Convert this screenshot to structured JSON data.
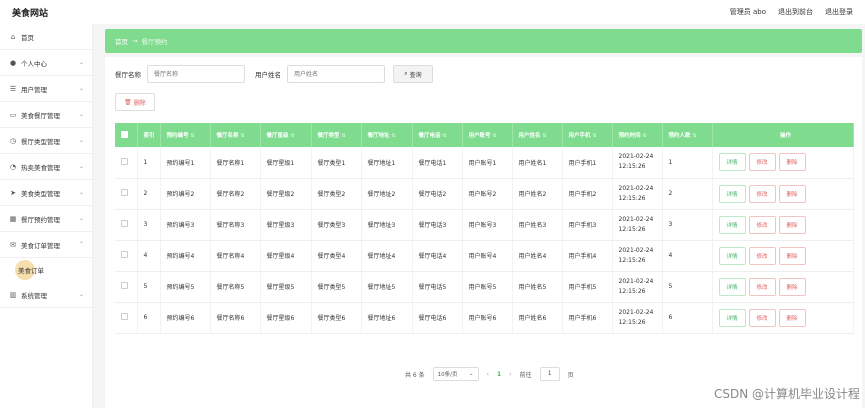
{
  "app": {
    "title": "美食网站"
  },
  "topnav": {
    "user_label": "管理员 abo",
    "frontend_link": "退出到前台",
    "logout": "退出登录"
  },
  "sidebar": {
    "items": [
      {
        "label": "首页",
        "icon": "home-icon",
        "glyph": "⌂",
        "chev": ""
      },
      {
        "label": "个人中心",
        "icon": "user-icon",
        "glyph": "●",
        "chev": "⌄"
      },
      {
        "label": "用户管理",
        "icon": "list-icon",
        "glyph": "☰",
        "chev": "⌄"
      },
      {
        "label": "美食餐厅管理",
        "icon": "ticket-icon",
        "glyph": "▭",
        "chev": "⌄"
      },
      {
        "label": "餐厅类型管理",
        "icon": "clock-icon",
        "glyph": "◷",
        "chev": "⌄"
      },
      {
        "label": "热卖美食管理",
        "icon": "history-icon",
        "glyph": "◔",
        "chev": "⌄"
      },
      {
        "label": "美食类型管理",
        "icon": "send-icon",
        "glyph": "➤",
        "chev": "⌄"
      },
      {
        "label": "餐厅预约管理",
        "icon": "grid-icon",
        "glyph": "▦",
        "chev": "⌄"
      },
      {
        "label": "美食订单管理",
        "icon": "mail-icon",
        "glyph": "✉",
        "chev": "⌃"
      }
    ],
    "submenu_label": "美食订单",
    "last_item": {
      "label": "系统管理",
      "icon": "chart-icon",
      "glyph": "▥",
      "chev": "⌄"
    }
  },
  "breadcrumb": {
    "home": "首页",
    "sep": "→",
    "current": "餐厅预约"
  },
  "search": {
    "field1_label": "餐厅名称",
    "field1_placeholder": "餐厅名称",
    "field2_label": "用户姓名",
    "field2_placeholder": "用户姓名",
    "button": "查询",
    "button_icon": "⌕"
  },
  "delete_button": "删除",
  "delete_icon": "🗑",
  "table": {
    "sort_glyph": "⇅",
    "headers": [
      "索引",
      "预约编号",
      "餐厅名称",
      "餐厅星级",
      "餐厅类型",
      "餐厅地址",
      "餐厅电话",
      "用户账号",
      "用户姓名",
      "用户手机",
      "预约时间",
      "预约人数",
      "操作"
    ],
    "rows": [
      {
        "idx": "1",
        "no": "预约编号1",
        "name": "餐厅名称1",
        "star": "餐厅星级1",
        "type": "餐厅类型1",
        "addr": "餐厅地址1",
        "phone": "餐厅电话1",
        "account": "用户账号1",
        "uname": "用户姓名1",
        "mobile": "用户手机1",
        "date": "2021-02-24",
        "time": "12:15:26",
        "count": "1"
      },
      {
        "idx": "2",
        "no": "预约编号2",
        "name": "餐厅名称2",
        "star": "餐厅星级2",
        "type": "餐厅类型2",
        "addr": "餐厅地址2",
        "phone": "餐厅电话2",
        "account": "用户账号2",
        "uname": "用户姓名2",
        "mobile": "用户手机2",
        "date": "2021-02-24",
        "time": "12:15:26",
        "count": "2"
      },
      {
        "idx": "3",
        "no": "预约编号3",
        "name": "餐厅名称3",
        "star": "餐厅星级3",
        "type": "餐厅类型3",
        "addr": "餐厅地址3",
        "phone": "餐厅电话3",
        "account": "用户账号3",
        "uname": "用户姓名3",
        "mobile": "用户手机3",
        "date": "2021-02-24",
        "time": "12:15:26",
        "count": "3"
      },
      {
        "idx": "4",
        "no": "预约编号4",
        "name": "餐厅名称4",
        "star": "餐厅星级4",
        "type": "餐厅类型4",
        "addr": "餐厅地址4",
        "phone": "餐厅电话4",
        "account": "用户账号4",
        "uname": "用户姓名4",
        "mobile": "用户手机4",
        "date": "2021-02-24",
        "time": "12:15:26",
        "count": "4"
      },
      {
        "idx": "5",
        "no": "预约编号5",
        "name": "餐厅名称5",
        "star": "餐厅星级5",
        "type": "餐厅类型5",
        "addr": "餐厅地址5",
        "phone": "餐厅电话5",
        "account": "用户账号5",
        "uname": "用户姓名5",
        "mobile": "用户手机5",
        "date": "2021-02-24",
        "time": "12:15:26",
        "count": "5"
      },
      {
        "idx": "6",
        "no": "预约编号6",
        "name": "餐厅名称6",
        "star": "餐厅星级6",
        "type": "餐厅类型6",
        "addr": "餐厅地址6",
        "phone": "餐厅电话6",
        "account": "用户账号6",
        "uname": "用户姓名6",
        "mobile": "用户手机6",
        "date": "2021-02-24",
        "time": "12:15:26",
        "count": "6"
      }
    ],
    "actions": {
      "detail": "详情",
      "edit": "修改",
      "remove": "删除"
    }
  },
  "pagination": {
    "total": "共 6 条",
    "page_size": "10条/页",
    "prev": "‹",
    "current": "1",
    "next": "›",
    "goto_label": "前往",
    "goto_value": "1",
    "page_suffix": "页",
    "caret": "⌄"
  },
  "watermark": "CSDN @计算机毕业设计程",
  "colors": {
    "accent": "#7fdc8e",
    "danger": "#e06060",
    "success": "#45b564"
  }
}
